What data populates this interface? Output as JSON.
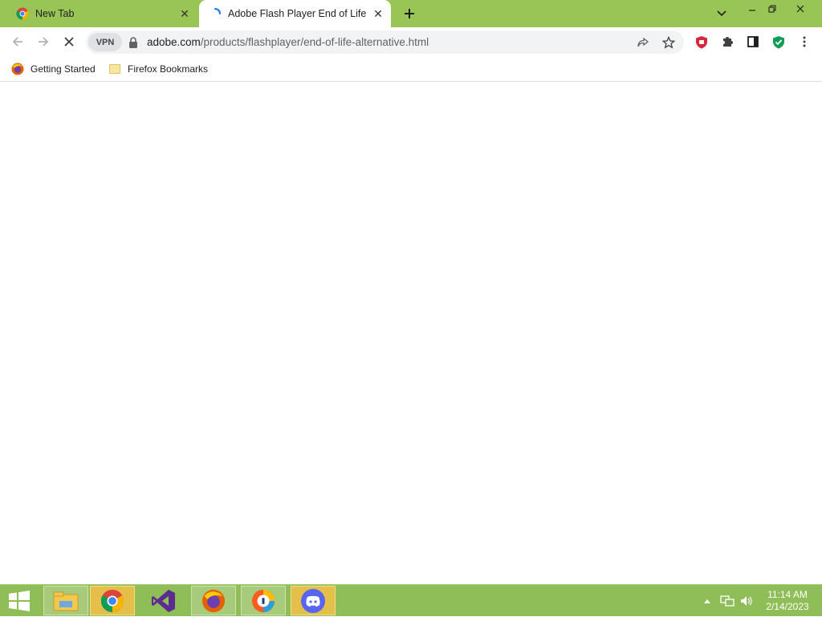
{
  "tabs": [
    {
      "title": "New Tab",
      "active": false
    },
    {
      "title": "Adobe Flash Player End of Life",
      "active": true,
      "loading": true
    }
  ],
  "toolbar": {
    "vpn_label": "VPN",
    "url_host": "adobe.com",
    "url_path": "/products/flashplayer/end-of-life-alternative.html"
  },
  "bookmarks": [
    {
      "label": "Getting Started",
      "icon": "firefox-icon"
    },
    {
      "label": "Firefox Bookmarks",
      "icon": "folder-icon"
    }
  ],
  "taskbar": {
    "apps": [
      "file-explorer",
      "chrome",
      "visual-studio",
      "firefox",
      "password-manager",
      "discord"
    ],
    "time": "11:14 AM",
    "date": "2/14/2023"
  },
  "colors": {
    "frame": "#99c456",
    "taskbar": "#8fbd57",
    "active_task": "#e4bf4a"
  }
}
